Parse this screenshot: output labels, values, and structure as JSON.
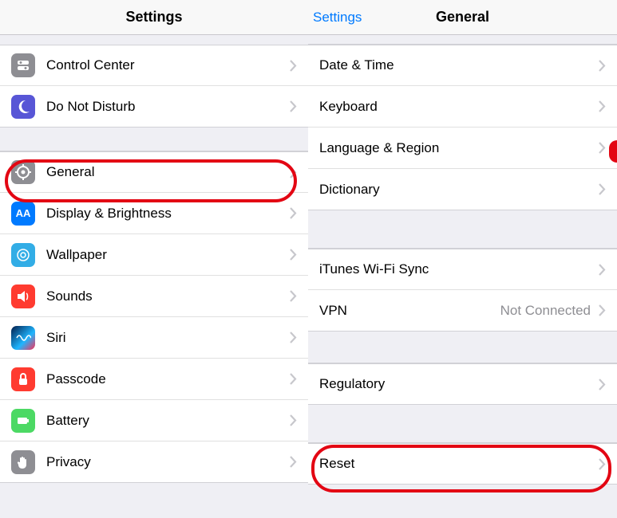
{
  "left": {
    "title": "Settings",
    "groups": [
      [
        {
          "label": "Control Center",
          "icon": "control-center-icon",
          "iconStyle": "icon-gray"
        },
        {
          "label": "Do Not Disturb",
          "icon": "moon-icon",
          "iconStyle": "icon-purple"
        }
      ],
      [
        {
          "label": "General",
          "icon": "gear-icon",
          "iconStyle": "icon-gray"
        },
        {
          "label": "Display & Brightness",
          "icon": "display-icon",
          "iconStyle": "icon-blue"
        },
        {
          "label": "Wallpaper",
          "icon": "wallpaper-icon",
          "iconStyle": "icon-teal"
        },
        {
          "label": "Sounds",
          "icon": "speaker-icon",
          "iconStyle": "icon-red"
        },
        {
          "label": "Siri",
          "icon": "siri-icon",
          "iconStyle": "icon-siri"
        },
        {
          "label": "Passcode",
          "icon": "lock-icon",
          "iconStyle": "icon-red"
        },
        {
          "label": "Battery",
          "icon": "battery-icon",
          "iconStyle": "icon-green"
        },
        {
          "label": "Privacy",
          "icon": "hand-icon",
          "iconStyle": "icon-gray"
        }
      ]
    ]
  },
  "right": {
    "backLabel": "Settings",
    "title": "General",
    "groups": [
      [
        {
          "label": "Date & Time"
        },
        {
          "label": "Keyboard"
        },
        {
          "label": "Language & Region"
        },
        {
          "label": "Dictionary"
        }
      ],
      [
        {
          "label": "iTunes Wi-Fi Sync"
        },
        {
          "label": "VPN",
          "detail": "Not Connected"
        }
      ],
      [
        {
          "label": "Regulatory"
        }
      ],
      [
        {
          "label": "Reset"
        }
      ]
    ]
  }
}
